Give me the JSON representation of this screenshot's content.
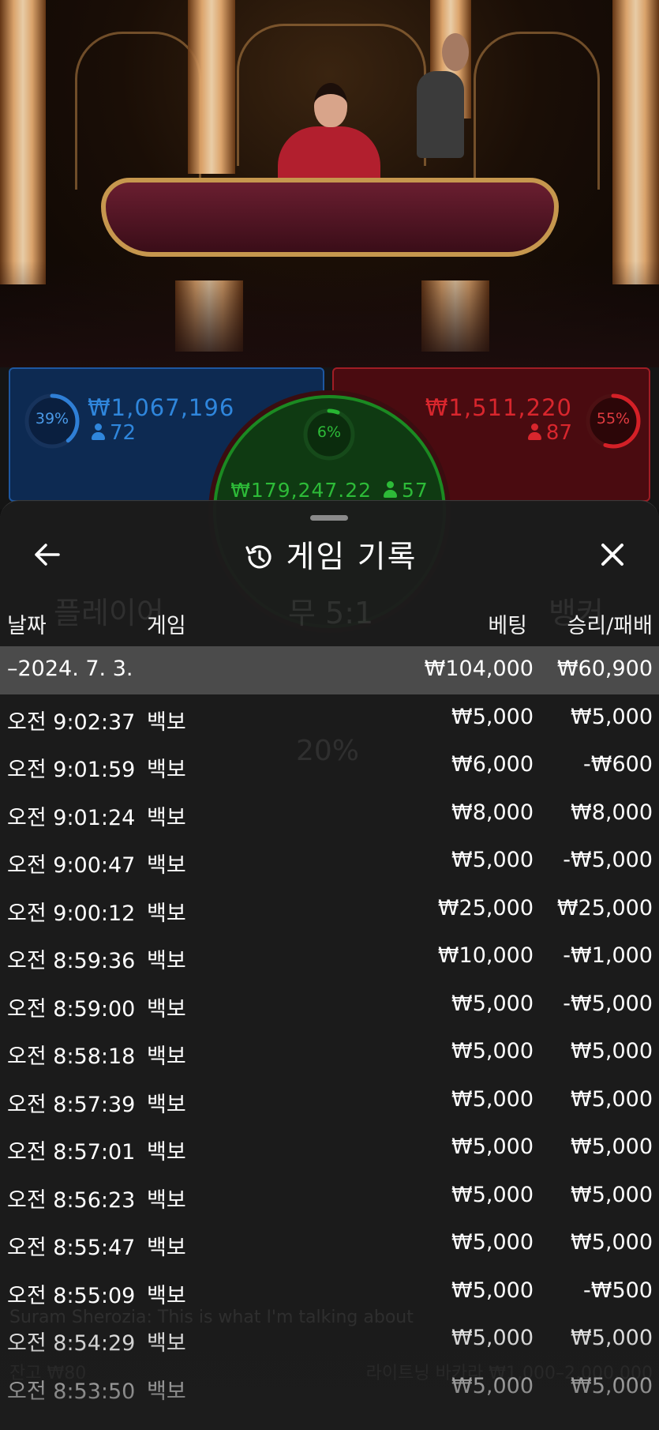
{
  "bet_spots": {
    "player": {
      "percent_label": "39%",
      "percent": 39,
      "amount": "₩1,067,196",
      "players": "72",
      "color": "#2f7fd6"
    },
    "tie": {
      "percent_label": "6%",
      "percent": 6,
      "amount": "₩179,247.22",
      "players": "57",
      "color": "#27b532"
    },
    "banker": {
      "percent_label": "55%",
      "percent": 55,
      "amount": "₩1,511,220",
      "players": "87",
      "color": "#d42027"
    }
  },
  "ghost_text": {
    "player": "플레이어",
    "tie": "무 5:1",
    "banker": "뱅커",
    "percent": "20%",
    "chat_user": "Suram Sherozia:",
    "chat_msg": "This is what I'm talking about",
    "balance": "잔고 ₩80",
    "table_name": "라이트닝 바카라 ₩1,000–2,000,000"
  },
  "sheet": {
    "title": "게임 기록",
    "icons": {
      "back": "arrow-left-icon",
      "history": "history-icon",
      "close": "close-icon"
    }
  },
  "columns": {
    "date": "날짜",
    "game": "게임",
    "bet": "베팅",
    "result": "승리/패배"
  },
  "summary": {
    "date": "–2024. 7. 3.",
    "bet": "₩104,000",
    "result": "₩60,900"
  },
  "rows": [
    {
      "time": "오전 9:02:37",
      "game": "백보",
      "bet": "₩5,000",
      "result": "₩5,000"
    },
    {
      "time": "오전 9:01:59",
      "game": "백보",
      "bet": "₩6,000",
      "result": "-₩600"
    },
    {
      "time": "오전 9:01:24",
      "game": "백보",
      "bet": "₩8,000",
      "result": "₩8,000"
    },
    {
      "time": "오전 9:00:47",
      "game": "백보",
      "bet": "₩5,000",
      "result": "-₩5,000"
    },
    {
      "time": "오전 9:00:12",
      "game": "백보",
      "bet": "₩25,000",
      "result": "₩25,000"
    },
    {
      "time": "오전 8:59:36",
      "game": "백보",
      "bet": "₩10,000",
      "result": "-₩1,000"
    },
    {
      "time": "오전 8:59:00",
      "game": "백보",
      "bet": "₩5,000",
      "result": "-₩5,000"
    },
    {
      "time": "오전 8:58:18",
      "game": "백보",
      "bet": "₩5,000",
      "result": "₩5,000"
    },
    {
      "time": "오전 8:57:39",
      "game": "백보",
      "bet": "₩5,000",
      "result": "₩5,000"
    },
    {
      "time": "오전 8:57:01",
      "game": "백보",
      "bet": "₩5,000",
      "result": "₩5,000"
    },
    {
      "time": "오전 8:56:23",
      "game": "백보",
      "bet": "₩5,000",
      "result": "₩5,000"
    },
    {
      "time": "오전 8:55:47",
      "game": "백보",
      "bet": "₩5,000",
      "result": "₩5,000"
    },
    {
      "time": "오전 8:55:09",
      "game": "백보",
      "bet": "₩5,000",
      "result": "-₩500"
    },
    {
      "time": "오전 8:54:29",
      "game": "백보",
      "bet": "₩5,000",
      "result": "₩5,000"
    },
    {
      "time": "오전 8:53:50",
      "game": "백보",
      "bet": "₩5,000",
      "result": "₩5,000"
    }
  ]
}
